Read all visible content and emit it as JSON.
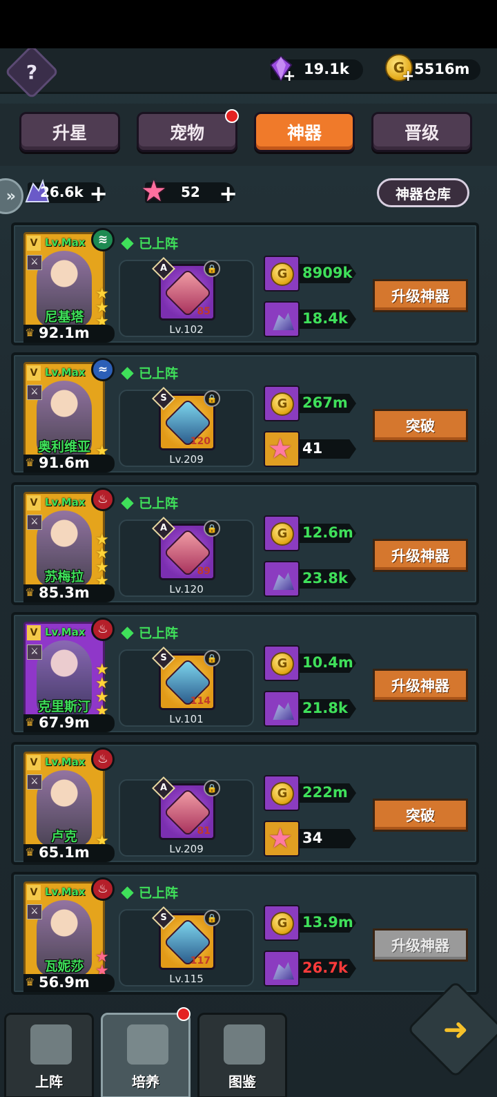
{
  "top": {
    "help_glyph": "?",
    "gems": "19.1k",
    "gold": "5516m"
  },
  "tabs": [
    {
      "label": "升星",
      "active": false
    },
    {
      "label": "宠物",
      "active": false,
      "badge": true
    },
    {
      "label": "神器",
      "active": true
    },
    {
      "label": "晋级",
      "active": false
    }
  ],
  "resources": {
    "ore": "26.6k",
    "star": "52",
    "warehouse_label": "神器仓库"
  },
  "deployed_label": "已上阵",
  "lvmax_label": "Lv.Max",
  "heroes": [
    {
      "name": "尼基塔",
      "power": "92.1m",
      "element": "wind",
      "deployed": true,
      "frame": "gold",
      "stars": 3,
      "star_color": "gold",
      "artifact": {
        "grade": "A",
        "frame": "purple",
        "num": "85",
        "level": "Lv.102"
      },
      "costs": [
        {
          "type": "gold",
          "amount": "8909k",
          "color": "green"
        },
        {
          "type": "ore",
          "amount": "18.4k",
          "color": "green"
        }
      ],
      "action": "升级神器",
      "action_enabled": true
    },
    {
      "name": "奥利维亚",
      "power": "91.6m",
      "element": "water",
      "deployed": true,
      "frame": "gold",
      "stars": 1,
      "star_color": "gold",
      "artifact": {
        "grade": "S",
        "frame": "gold",
        "num": "120",
        "level": "Lv.209"
      },
      "costs": [
        {
          "type": "gold",
          "amount": "267m",
          "color": "green"
        },
        {
          "type": "star",
          "amount": "41",
          "color": "white"
        }
      ],
      "action": "突破",
      "action_enabled": true
    },
    {
      "name": "苏梅拉",
      "power": "85.3m",
      "element": "fire",
      "deployed": true,
      "frame": "gold",
      "stars": 4,
      "star_color": "gold",
      "artifact": {
        "grade": "A",
        "frame": "purple",
        "num": "89",
        "level": "Lv.120"
      },
      "costs": [
        {
          "type": "gold",
          "amount": "12.6m",
          "color": "green"
        },
        {
          "type": "ore",
          "amount": "23.8k",
          "color": "green"
        }
      ],
      "action": "升级神器",
      "action_enabled": true
    },
    {
      "name": "克里斯汀",
      "power": "67.9m",
      "element": "fire",
      "deployed": true,
      "frame": "purple",
      "stars": 4,
      "star_color": "gold",
      "artifact": {
        "grade": "S",
        "frame": "gold",
        "num": "114",
        "level": "Lv.101"
      },
      "costs": [
        {
          "type": "gold",
          "amount": "10.4m",
          "color": "green"
        },
        {
          "type": "ore",
          "amount": "21.8k",
          "color": "green"
        }
      ],
      "action": "升级神器",
      "action_enabled": true
    },
    {
      "name": "卢克",
      "power": "65.1m",
      "element": "fire",
      "deployed": false,
      "frame": "gold",
      "stars": 1,
      "star_color": "gold",
      "artifact": {
        "grade": "A",
        "frame": "purple",
        "num": "81",
        "level": "Lv.209"
      },
      "costs": [
        {
          "type": "gold",
          "amount": "222m",
          "color": "green"
        },
        {
          "type": "star",
          "amount": "34",
          "color": "white"
        }
      ],
      "action": "突破",
      "action_enabled": true
    },
    {
      "name": "瓦妮莎",
      "power": "56.9m",
      "element": "fire",
      "deployed": true,
      "frame": "gold",
      "stars": 2,
      "star_color": "pink",
      "artifact": {
        "grade": "S",
        "frame": "gold",
        "num": "117",
        "level": "Lv.115"
      },
      "costs": [
        {
          "type": "gold",
          "amount": "13.9m",
          "color": "green"
        },
        {
          "type": "ore",
          "amount": "26.7k",
          "color": "red"
        }
      ],
      "action": "升级神器",
      "action_enabled": false
    }
  ],
  "nav": [
    {
      "label": "上阵",
      "active": false
    },
    {
      "label": "培养",
      "active": true,
      "badge": true
    },
    {
      "label": "图鉴",
      "active": false
    }
  ],
  "colors": {
    "accent_orange": "#f07a2a",
    "green_text": "#3fe05a",
    "red_text": "#ff3b3b"
  }
}
